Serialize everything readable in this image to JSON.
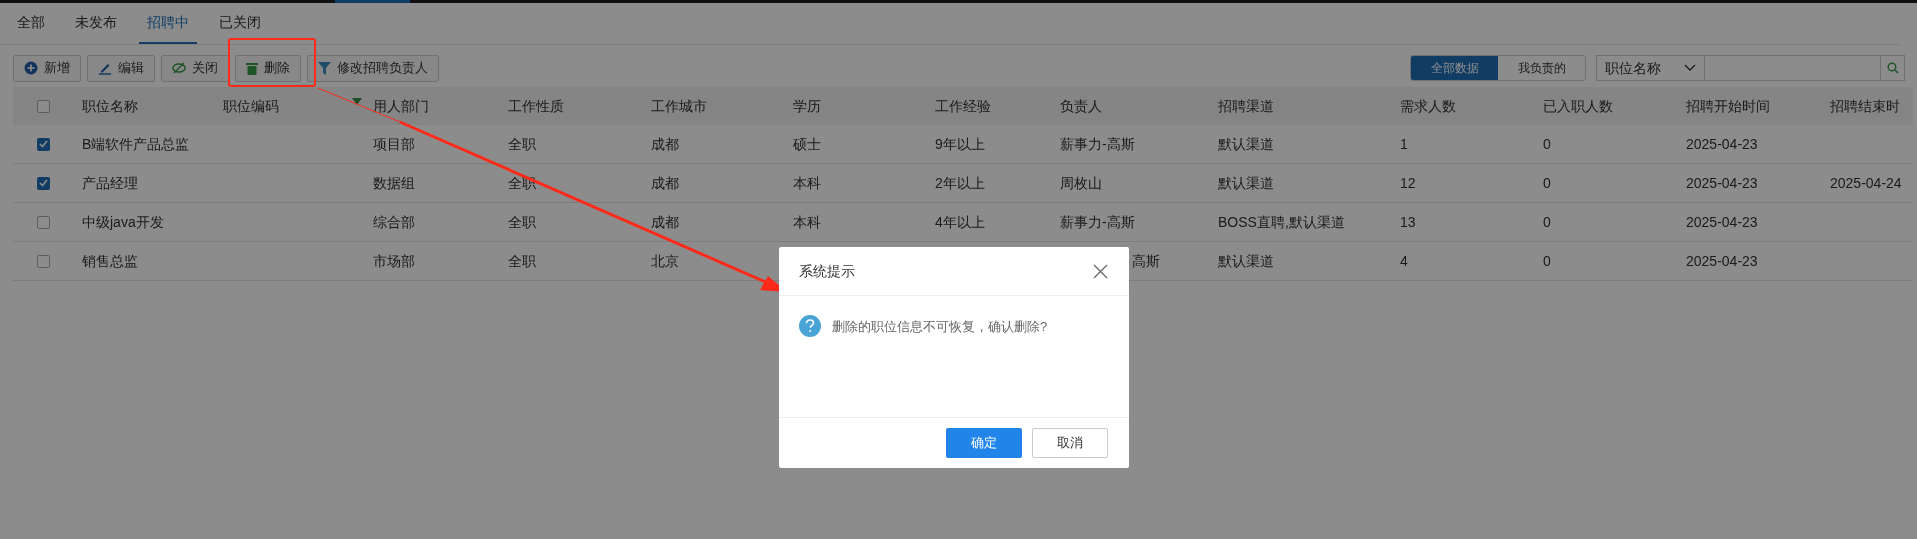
{
  "tabs": [
    {
      "label": "全部",
      "selected": false
    },
    {
      "label": "未发布",
      "selected": false
    },
    {
      "label": "招聘中",
      "selected": true
    },
    {
      "label": "已关闭",
      "selected": false
    }
  ],
  "toolbar": [
    {
      "kind": "add",
      "label": "新增"
    },
    {
      "kind": "edit",
      "label": "编辑"
    },
    {
      "kind": "close",
      "label": "关闭"
    },
    {
      "kind": "delete",
      "label": "删除"
    },
    {
      "kind": "filter",
      "label": "修改招聘负责人"
    }
  ],
  "scope": [
    {
      "label": "全部数据",
      "selected": true
    },
    {
      "label": "我负责的",
      "selected": false
    }
  ],
  "search": {
    "field": "职位名称"
  },
  "table": {
    "all_checked": false,
    "columns": [
      "职位名称",
      "职位编码",
      "用人部门",
      "工作性质",
      "工作城市",
      "学历",
      "工作经验",
      "负责人",
      "招聘渠道",
      "需求人数",
      "已入职人数",
      "招聘开始时间",
      "招聘结束时"
    ],
    "rows": [
      {
        "checked": true,
        "cells": [
          "B端软件产品总监",
          "",
          "项目部",
          "全职",
          "成都",
          "硕士",
          "9年以上",
          "薪事力-高斯",
          "默认渠道",
          "1",
          "0",
          "2025-04-23",
          ""
        ]
      },
      {
        "checked": true,
        "cells": [
          "产品经理",
          "",
          "数据组",
          "全职",
          "成都",
          "本科",
          "2年以上",
          "周枚山",
          "默认渠道",
          "12",
          "0",
          "2025-04-23",
          "2025-04-24"
        ]
      },
      {
        "checked": false,
        "cells": [
          "中级java开发",
          "",
          "综合部",
          "全职",
          "成都",
          "本科",
          "4年以上",
          "薪事力-高斯",
          "BOSS直聘,默认渠道",
          "13",
          "0",
          "2025-04-23",
          ""
        ]
      },
      {
        "checked": false,
        "cells": [
          "销售总监",
          "",
          "市场部",
          "全职",
          "北京",
          "",
          "",
          "高斯",
          "默认渠道",
          "4",
          "0",
          "2025-04-23",
          ""
        ]
      }
    ]
  },
  "dialog": {
    "title": "系统提示",
    "message": "删除的职位信息不可恢复，确认删除?",
    "buttons": [
      {
        "kind": "primary",
        "label": "确定"
      },
      {
        "kind": "default",
        "label": "取消"
      }
    ]
  }
}
